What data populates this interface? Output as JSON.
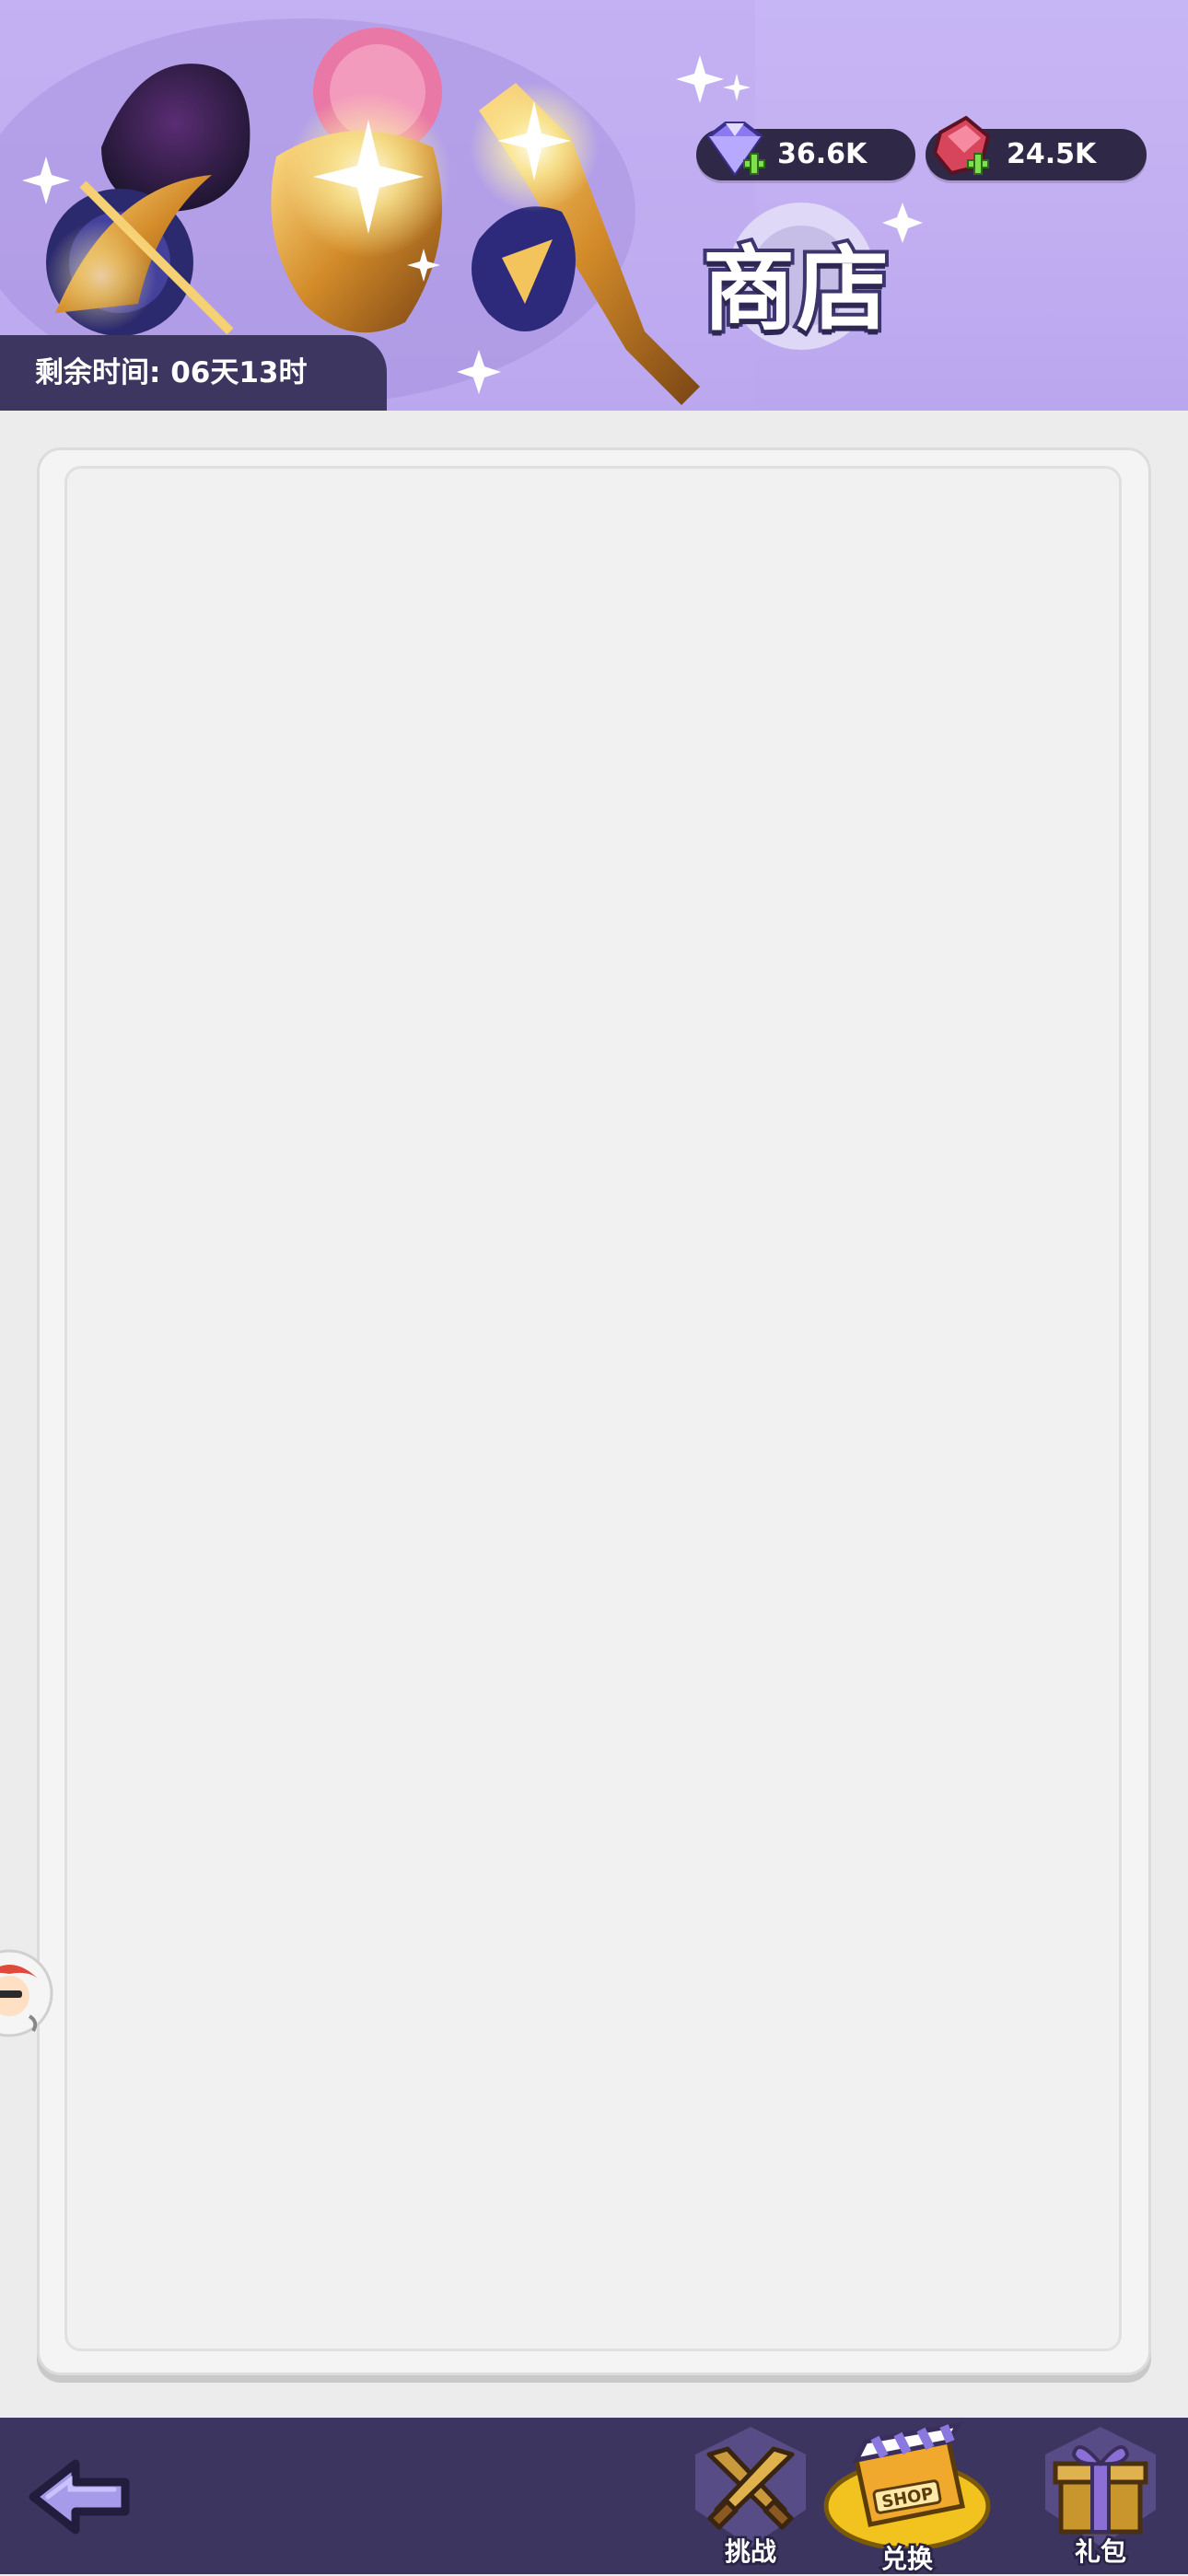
{
  "header": {
    "title": "商店",
    "timer_text": "剩余时间: 06天13时",
    "currencies": [
      {
        "icon": "gem-icon",
        "amount": "36.6K"
      },
      {
        "icon": "ruby-icon",
        "amount": "24.5K"
      }
    ]
  },
  "nav": {
    "back_icon": "back-arrow-icon",
    "items": [
      {
        "label": "挑战",
        "icon": "crossed-swords-icon",
        "active": false
      },
      {
        "label": "兑换",
        "icon": "shop-stall-icon",
        "active": true
      },
      {
        "label": "礼包",
        "icon": "gift-box-icon",
        "active": false
      }
    ]
  },
  "colors": {
    "banner": "#c4b2f3",
    "nav_bar": "#3c3560",
    "panel": "#f1f1f1",
    "currency_pill": "#2f2846"
  }
}
